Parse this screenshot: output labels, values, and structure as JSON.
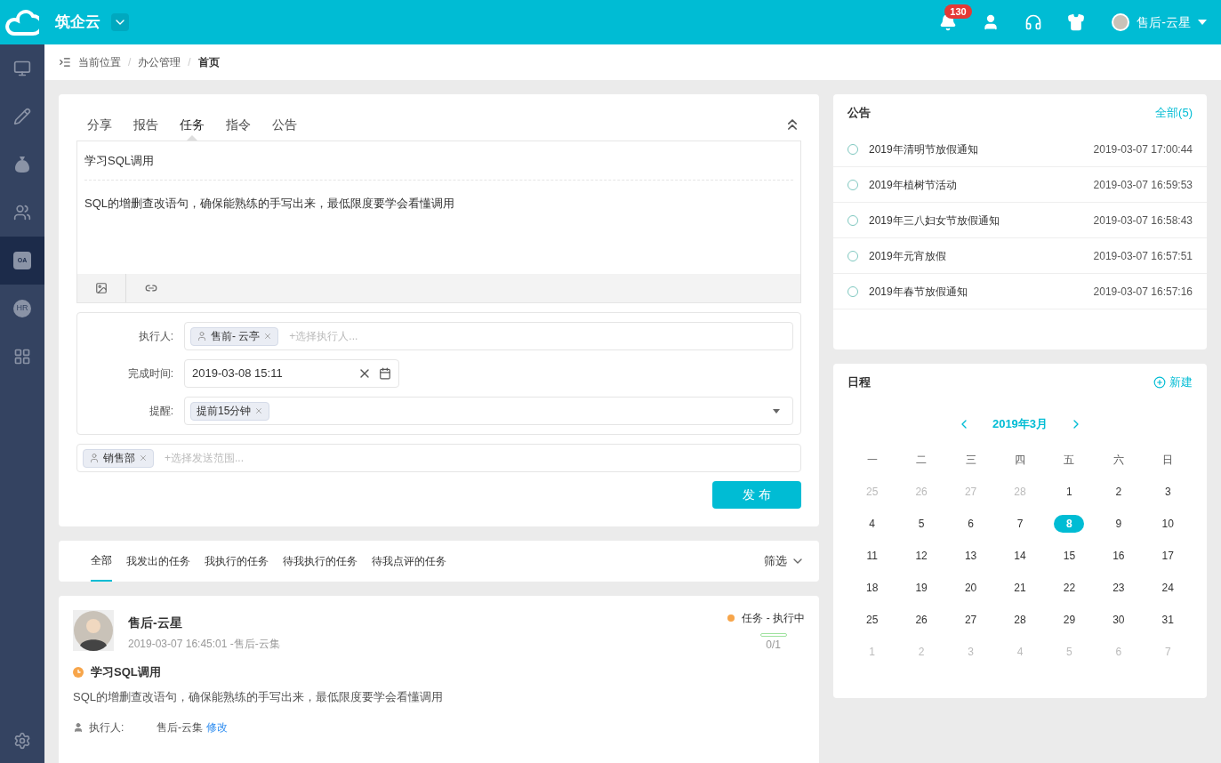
{
  "header": {
    "app_name": "筑企云",
    "notification_count": "130",
    "user_name": "售后-云星"
  },
  "sidebar": {
    "items": [
      {
        "kind": "monitor",
        "selected": false
      },
      {
        "kind": "pencil",
        "selected": false
      },
      {
        "kind": "moneybag",
        "selected": false
      },
      {
        "kind": "users",
        "selected": false
      },
      {
        "kind": "office",
        "text": "OA",
        "selected": true
      },
      {
        "kind": "hr",
        "text": "HR",
        "selected": false
      },
      {
        "kind": "grid",
        "selected": false
      }
    ]
  },
  "breadcrumb": {
    "separator": "/",
    "items": [
      "当前位置",
      "办公管理",
      "首页"
    ]
  },
  "composer": {
    "tabs": [
      {
        "label": "分享",
        "selected": false
      },
      {
        "label": "报告",
        "selected": false
      },
      {
        "label": "任务",
        "selected": true
      },
      {
        "label": "指令",
        "selected": false
      },
      {
        "label": "公告",
        "selected": false
      }
    ],
    "title": "学习SQL调用",
    "body": "SQL的增删查改语句，确保能熟练的手写出来，最低限度要学会看懂调用",
    "executor": {
      "label": "执行人:",
      "tag": "售前- 云亭",
      "placeholder": "+选择执行人..."
    },
    "deadline": {
      "label": "完成时间:",
      "value": "2019-03-08 15:11"
    },
    "reminder": {
      "label": "提醒:",
      "tag": "提前15分钟"
    },
    "scope": {
      "tag": "销售部",
      "placeholder": "+选择发送范围..."
    },
    "publish": "发 布"
  },
  "task_tabs": {
    "tabs": [
      {
        "label": "全部",
        "selected": true
      },
      {
        "label": "我发出的任务",
        "selected": false
      },
      {
        "label": "我执行的任务",
        "selected": false
      },
      {
        "label": "待我执行的任务",
        "selected": false
      },
      {
        "label": "待我点评的任务",
        "selected": false
      }
    ],
    "filter": "筛选"
  },
  "task": {
    "author": "售后-云星",
    "meta": "2019-03-07 16:45:01 -售后-云集",
    "status": "任务 - 执行中",
    "color": "#f7a54a",
    "level": 0,
    "progress": "0/1",
    "title": "学习SQL调用",
    "body": "SQL的增删查改语句，确保能熟练的手写出来，最低限度要学会看懂调用",
    "executor_label": "执行人:",
    "executor": "售后-云集",
    "edit": "修改"
  },
  "notices": {
    "title": "公告",
    "all": "全部(5)",
    "items": [
      {
        "title": "2019年清明节放假通知",
        "time": "2019-03-07 17:00:44"
      },
      {
        "title": "2019年植树节活动",
        "time": "2019-03-07 16:59:53"
      },
      {
        "title": "2019年三八妇女节放假通知",
        "time": "2019-03-07 16:58:43"
      },
      {
        "title": "2019年元宵放假",
        "time": "2019-03-07 16:57:51"
      },
      {
        "title": "2019年春节放假通知",
        "time": "2019-03-07 16:57:16"
      }
    ]
  },
  "schedule": {
    "title": "日程",
    "new": "新建",
    "month": "2019年3月",
    "weekdays": [
      "一",
      "二",
      "三",
      "四",
      "五",
      "六",
      "日"
    ],
    "days": [
      {
        "d": "25",
        "muted": true,
        "selected": false
      },
      {
        "d": "26",
        "muted": true,
        "selected": false
      },
      {
        "d": "27",
        "muted": true,
        "selected": false
      },
      {
        "d": "28",
        "muted": true,
        "selected": false
      },
      {
        "d": "1",
        "muted": false,
        "selected": false
      },
      {
        "d": "2",
        "muted": false,
        "selected": false
      },
      {
        "d": "3",
        "muted": false,
        "selected": false
      },
      {
        "d": "4",
        "muted": false,
        "selected": false
      },
      {
        "d": "5",
        "muted": false,
        "selected": false
      },
      {
        "d": "6",
        "muted": false,
        "selected": false
      },
      {
        "d": "7",
        "muted": false,
        "selected": false
      },
      {
        "d": "8",
        "muted": false,
        "selected": true
      },
      {
        "d": "9",
        "muted": false,
        "selected": false
      },
      {
        "d": "10",
        "muted": false,
        "selected": false
      },
      {
        "d": "11",
        "muted": false,
        "selected": false
      },
      {
        "d": "12",
        "muted": false,
        "selected": false
      },
      {
        "d": "13",
        "muted": false,
        "selected": false
      },
      {
        "d": "14",
        "muted": false,
        "selected": false
      },
      {
        "d": "15",
        "muted": false,
        "selected": false
      },
      {
        "d": "16",
        "muted": false,
        "selected": false
      },
      {
        "d": "17",
        "muted": false,
        "selected": false
      },
      {
        "d": "18",
        "muted": false,
        "selected": false
      },
      {
        "d": "19",
        "muted": false,
        "selected": false
      },
      {
        "d": "20",
        "muted": false,
        "selected": false
      },
      {
        "d": "21",
        "muted": false,
        "selected": false
      },
      {
        "d": "22",
        "muted": false,
        "selected": false
      },
      {
        "d": "23",
        "muted": false,
        "selected": false
      },
      {
        "d": "24",
        "muted": false,
        "selected": false
      },
      {
        "d": "25",
        "muted": false,
        "selected": false
      },
      {
        "d": "26",
        "muted": false,
        "selected": false
      },
      {
        "d": "27",
        "muted": false,
        "selected": false
      },
      {
        "d": "28",
        "muted": false,
        "selected": false
      },
      {
        "d": "29",
        "muted": false,
        "selected": false
      },
      {
        "d": "30",
        "muted": false,
        "selected": false
      },
      {
        "d": "31",
        "muted": false,
        "selected": false
      },
      {
        "d": "1",
        "muted": true,
        "selected": false
      },
      {
        "d": "2",
        "muted": true,
        "selected": false
      },
      {
        "d": "3",
        "muted": true,
        "selected": false
      },
      {
        "d": "4",
        "muted": true,
        "selected": false
      },
      {
        "d": "5",
        "muted": true,
        "selected": false
      },
      {
        "d": "6",
        "muted": true,
        "selected": false
      },
      {
        "d": "7",
        "muted": true,
        "selected": false
      }
    ]
  }
}
